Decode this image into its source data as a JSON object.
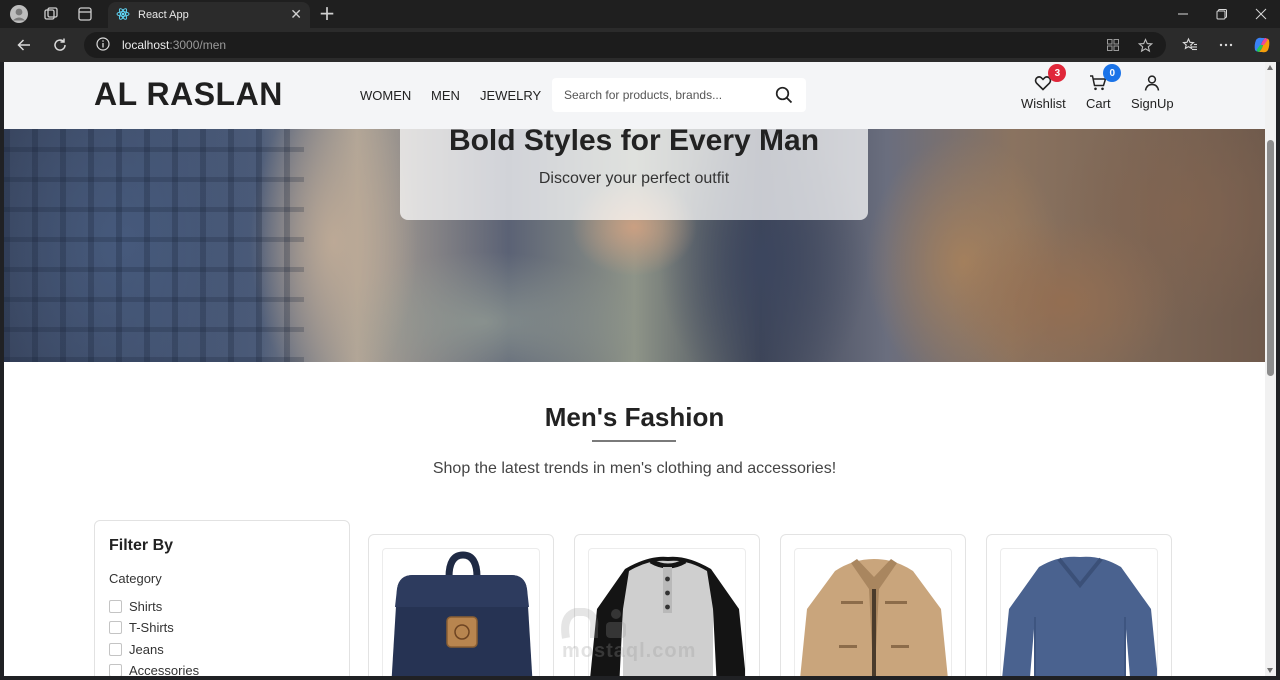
{
  "browser": {
    "tab_title": "React App",
    "tab_close": "✕",
    "new_tab": "+",
    "url_host": "localhost",
    "url_path": ":3000/men"
  },
  "site": {
    "logo": "AL RASLAN",
    "nav": [
      "WOMEN",
      "MEN",
      "JEWELRY"
    ],
    "search_placeholder": "Search for products, brands...",
    "wishlist_label": "Wishlist",
    "wishlist_count": "3",
    "cart_label": "Cart",
    "cart_count": "0",
    "signup_label": "SignUp"
  },
  "hero": {
    "title": "Bold Styles for Every Man",
    "subtitle": "Discover your perfect outfit"
  },
  "section": {
    "title": "Men's Fashion",
    "subtitle": "Shop the latest trends in men's clothing and accessories!"
  },
  "filter": {
    "title": "Filter By",
    "category_label": "Category",
    "options": [
      "Shirts",
      "T-Shirts",
      "Jeans",
      "Accessories"
    ]
  },
  "products": [
    {
      "image": "backpack-image"
    },
    {
      "image": "henley-shirt-image"
    },
    {
      "image": "jacket-image"
    },
    {
      "image": "longsleeve-shirt-image"
    }
  ],
  "colors": {
    "wishlist_badge": "#e0273a",
    "cart_badge": "#1a73e8",
    "header_bg": "#f4f5f7"
  },
  "watermark": "mostaql.com"
}
